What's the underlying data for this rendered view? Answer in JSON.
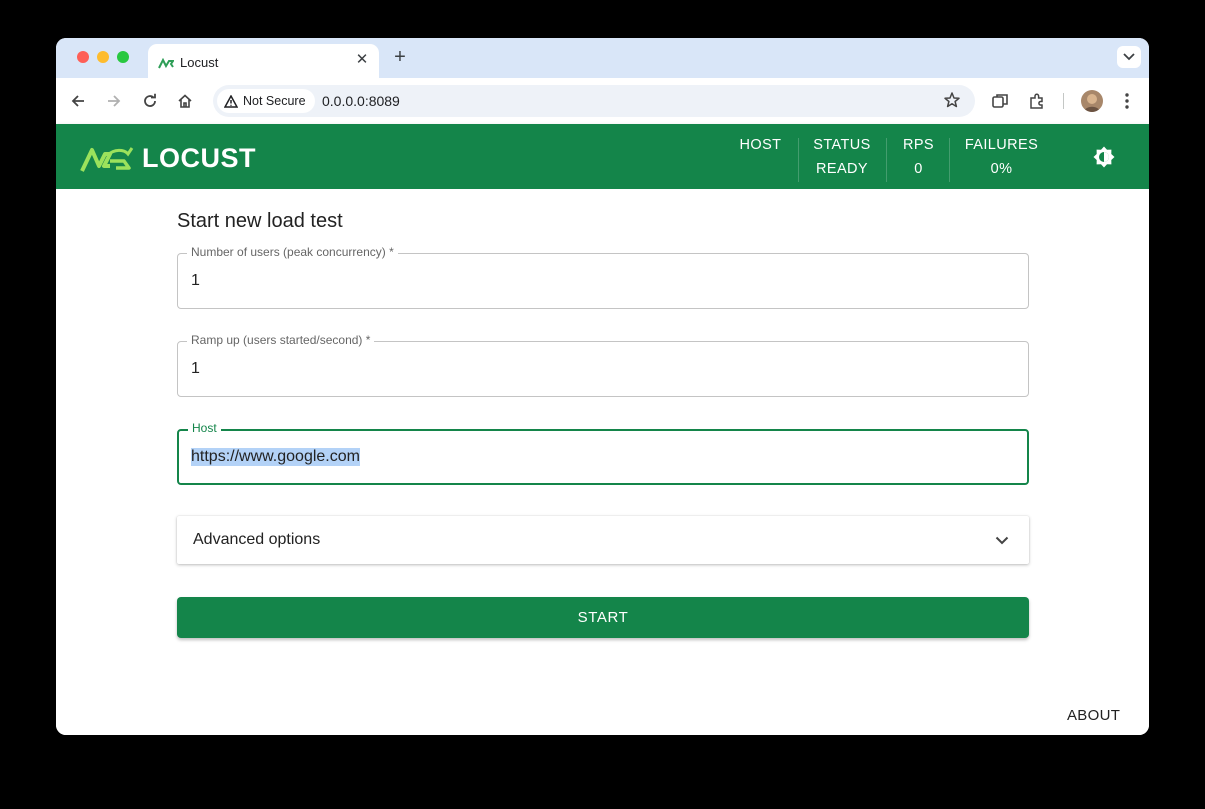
{
  "browser": {
    "tab_title": "Locust",
    "security_label": "Not Secure",
    "url": "0.0.0.0:8089"
  },
  "header": {
    "logo_text": "LOCUST",
    "stats": [
      {
        "label": "HOST",
        "value": ""
      },
      {
        "label": "STATUS",
        "value": "READY"
      },
      {
        "label": "RPS",
        "value": "0"
      },
      {
        "label": "FAILURES",
        "value": "0%"
      }
    ]
  },
  "form": {
    "title": "Start new load test",
    "users": {
      "label": "Number of users (peak concurrency)",
      "required": "*",
      "value": "1"
    },
    "ramp_up": {
      "label": "Ramp up (users started/second)",
      "required": "*",
      "value": "1"
    },
    "host": {
      "label": "Host",
      "value": "https://www.google.com"
    },
    "advanced_label": "Advanced options",
    "start_label": "START"
  },
  "footer": {
    "about_label": "ABOUT"
  },
  "colors": {
    "brand_green": "#14854a",
    "logo_green": "#9be25c"
  }
}
